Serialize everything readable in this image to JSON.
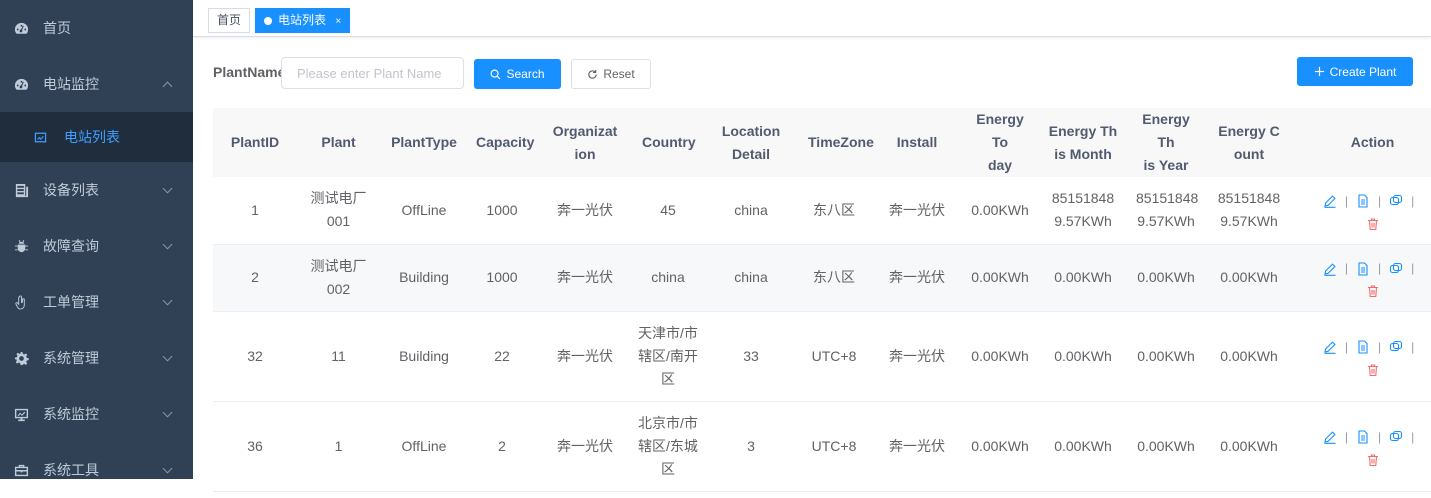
{
  "sidebar": {
    "items": [
      {
        "label": "首页",
        "icon": "dashboard-icon"
      },
      {
        "label": "电站监控",
        "icon": "dashboard-icon",
        "expanded": true
      },
      {
        "label": "设备列表",
        "icon": "server-icon"
      },
      {
        "label": "故障查询",
        "icon": "bug-icon"
      },
      {
        "label": "工单管理",
        "icon": "hand-icon"
      },
      {
        "label": "系统管理",
        "icon": "gear-icon"
      },
      {
        "label": "系统监控",
        "icon": "monitor-icon"
      },
      {
        "label": "系统工具",
        "icon": "toolbox-icon"
      }
    ],
    "subitem": {
      "label": "电站列表",
      "icon": "chart-icon"
    }
  },
  "tags": {
    "home": "首页",
    "active": "电站列表",
    "close": "×"
  },
  "search": {
    "label": "PlantName",
    "placeholder": "Please enter Plant Name",
    "search_button": "Search",
    "reset_button": "Reset",
    "create_button": "Create Plant"
  },
  "table": {
    "headers": [
      [
        "PlantID"
      ],
      [
        "Plant"
      ],
      [
        "PlantType"
      ],
      [
        "Capacity"
      ],
      [
        "Organizat",
        "ion"
      ],
      [
        "Country"
      ],
      [
        "Location",
        "Detail"
      ],
      [
        "TimeZone"
      ],
      [
        "Install"
      ],
      [
        "Energy To",
        "day"
      ],
      [
        "Energy Th",
        "is Month"
      ],
      [
        "Energy Th",
        "is Year"
      ],
      [
        "Energy C",
        "ount"
      ],
      [
        "Action"
      ]
    ],
    "rows": [
      [
        [
          "1"
        ],
        [
          "测试电厂",
          "001"
        ],
        [
          "OffLine"
        ],
        [
          "1000"
        ],
        [
          "奔一光伏"
        ],
        [
          "45"
        ],
        [
          "china"
        ],
        [
          "东八区"
        ],
        [
          "奔一光伏"
        ],
        [
          "0.00KWh"
        ],
        [
          "85151848",
          "9.57KWh"
        ],
        [
          "85151848",
          "9.57KWh"
        ],
        [
          "85151848",
          "9.57KWh"
        ]
      ],
      [
        [
          "2"
        ],
        [
          "测试电厂",
          "002"
        ],
        [
          "Building"
        ],
        [
          "1000"
        ],
        [
          "奔一光伏"
        ],
        [
          "china"
        ],
        [
          "china"
        ],
        [
          "东八区"
        ],
        [
          "奔一光伏"
        ],
        [
          "0.00KWh"
        ],
        [
          "0.00KWh"
        ],
        [
          "0.00KWh"
        ],
        [
          "0.00KWh"
        ]
      ],
      [
        [
          "32"
        ],
        [
          "11"
        ],
        [
          "Building"
        ],
        [
          "22"
        ],
        [
          "奔一光伏"
        ],
        [
          "天津市/市",
          "辖区/南开",
          "区"
        ],
        [
          "33"
        ],
        [
          "UTC+8"
        ],
        [
          "奔一光伏"
        ],
        [
          "0.00KWh"
        ],
        [
          "0.00KWh"
        ],
        [
          "0.00KWh"
        ],
        [
          "0.00KWh"
        ]
      ],
      [
        [
          "36"
        ],
        [
          "1"
        ],
        [
          "OffLine"
        ],
        [
          "2"
        ],
        [
          "奔一光伏"
        ],
        [
          "北京市/市",
          "辖区/东城",
          "区"
        ],
        [
          "3"
        ],
        [
          "UTC+8"
        ],
        [
          "奔一光伏"
        ],
        [
          "0.00KWh"
        ],
        [
          "0.00KWh"
        ],
        [
          "0.00KWh"
        ],
        [
          "0.00KWh"
        ]
      ]
    ],
    "action_separator": "|"
  },
  "colors": {
    "sidebar_bg": "#304156",
    "sidebar_sub_bg": "#1f2d3d",
    "primary": "#1890ff",
    "danger": "#f56c6c"
  }
}
